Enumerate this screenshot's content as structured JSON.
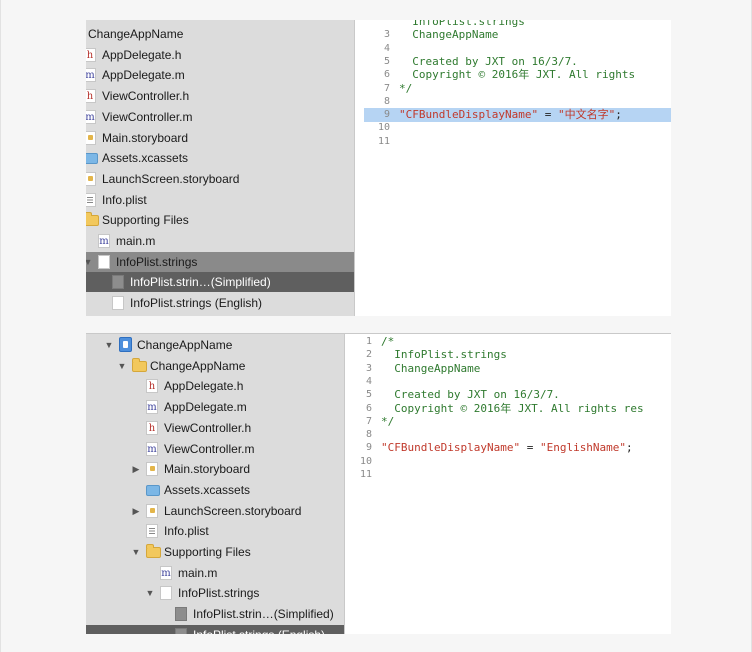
{
  "screens": [
    {
      "id": "simplified",
      "tree": [
        {
          "label": "ChangeAppName",
          "icon": "folder",
          "depth": 1,
          "disclosure": "open"
        },
        {
          "label": "AppDelegate.h",
          "icon": "h",
          "depth": 2
        },
        {
          "label": "AppDelegate.m",
          "icon": "m",
          "depth": 2
        },
        {
          "label": "ViewController.h",
          "icon": "h",
          "depth": 2
        },
        {
          "label": "ViewController.m",
          "icon": "m",
          "depth": 2
        },
        {
          "label": "Main.storyboard",
          "icon": "storyboard",
          "depth": 2,
          "disclosure": "closed"
        },
        {
          "label": "Assets.xcassets",
          "icon": "xcassets",
          "depth": 2
        },
        {
          "label": "LaunchScreen.storyboard",
          "icon": "storyboard",
          "depth": 2,
          "disclosure": "closed"
        },
        {
          "label": "Info.plist",
          "icon": "plist",
          "depth": 2
        },
        {
          "label": "Supporting Files",
          "icon": "folder",
          "depth": 2,
          "disclosure": "open"
        },
        {
          "label": "main.m",
          "icon": "m",
          "depth": 3
        },
        {
          "label": "InfoPlist.strings",
          "icon": "doc",
          "depth": 3,
          "disclosure": "open",
          "state": "selected"
        },
        {
          "label": "InfoPlist.strin…(Simplified)",
          "icon": "doc-grey",
          "depth": 4,
          "state": "active"
        },
        {
          "label": "InfoPlist.strings (English)",
          "icon": "doc",
          "depth": 4
        }
      ],
      "code": [
        {
          "n": "",
          "segments": [
            {
              "t": "  InfoPlist.strings",
              "c": "comment"
            }
          ]
        },
        {
          "n": "3",
          "segments": [
            {
              "t": "  ChangeAppName",
              "c": "comment"
            }
          ]
        },
        {
          "n": "4",
          "segments": []
        },
        {
          "n": "5",
          "segments": [
            {
              "t": "  Created by JXT on 16/3/7.",
              "c": "comment"
            }
          ]
        },
        {
          "n": "6",
          "segments": [
            {
              "t": "  Copyright © 2016年 JXT. All rights",
              "c": "comment"
            }
          ]
        },
        {
          "n": "7",
          "segments": [
            {
              "t": "*/",
              "c": "comment"
            }
          ]
        },
        {
          "n": "8",
          "segments": []
        },
        {
          "n": "9",
          "highlight": true,
          "segments": [
            {
              "t": "\"CFBundleDisplayName\"",
              "c": "str"
            },
            {
              "t": " = ",
              "c": "op"
            },
            {
              "t": "\"中文名字\"",
              "c": "str"
            },
            {
              "t": ";",
              "c": "op"
            }
          ]
        },
        {
          "n": "10",
          "segments": []
        },
        {
          "n": "11",
          "segments": []
        }
      ]
    },
    {
      "id": "english",
      "tree": [
        {
          "label": "ChangeAppName",
          "icon": "project",
          "depth": 0,
          "disclosure": "open"
        },
        {
          "label": "ChangeAppName",
          "icon": "folder",
          "depth": 1,
          "disclosure": "open"
        },
        {
          "label": "AppDelegate.h",
          "icon": "h",
          "depth": 2
        },
        {
          "label": "AppDelegate.m",
          "icon": "m",
          "depth": 2
        },
        {
          "label": "ViewController.h",
          "icon": "h",
          "depth": 2
        },
        {
          "label": "ViewController.m",
          "icon": "m",
          "depth": 2
        },
        {
          "label": "Main.storyboard",
          "icon": "storyboard",
          "depth": 2,
          "disclosure": "closed"
        },
        {
          "label": "Assets.xcassets",
          "icon": "xcassets",
          "depth": 2
        },
        {
          "label": "LaunchScreen.storyboard",
          "icon": "storyboard",
          "depth": 2,
          "disclosure": "closed"
        },
        {
          "label": "Info.plist",
          "icon": "plist",
          "depth": 2
        },
        {
          "label": "Supporting Files",
          "icon": "folder",
          "depth": 2,
          "disclosure": "open"
        },
        {
          "label": "main.m",
          "icon": "m",
          "depth": 3
        },
        {
          "label": "InfoPlist.strings",
          "icon": "doc",
          "depth": 3,
          "disclosure": "open"
        },
        {
          "label": "InfoPlist.strin…(Simplified)",
          "icon": "doc-grey",
          "depth": 4
        },
        {
          "label": "InfoPlist.strings (English)",
          "icon": "doc-grey",
          "depth": 4,
          "state": "active"
        }
      ],
      "code": [
        {
          "n": "1",
          "segments": [
            {
              "t": "/*",
              "c": "comment"
            }
          ]
        },
        {
          "n": "2",
          "segments": [
            {
              "t": "  InfoPlist.strings",
              "c": "comment"
            }
          ]
        },
        {
          "n": "3",
          "segments": [
            {
              "t": "  ChangeAppName",
              "c": "comment"
            }
          ]
        },
        {
          "n": "4",
          "segments": []
        },
        {
          "n": "5",
          "segments": [
            {
              "t": "  Created by JXT on 16/3/7.",
              "c": "comment"
            }
          ]
        },
        {
          "n": "6",
          "segments": [
            {
              "t": "  Copyright © 2016年 JXT. All rights res",
              "c": "comment"
            }
          ]
        },
        {
          "n": "7",
          "segments": [
            {
              "t": "*/",
              "c": "comment"
            }
          ]
        },
        {
          "n": "8",
          "segments": []
        },
        {
          "n": "9",
          "segments": [
            {
              "t": "\"CFBundleDisplayName\"",
              "c": "str"
            },
            {
              "t": " = ",
              "c": "op"
            },
            {
              "t": "\"EnglishName\"",
              "c": "str"
            },
            {
              "t": ";",
              "c": "op"
            }
          ]
        },
        {
          "n": "10",
          "segments": []
        },
        {
          "n": "11",
          "segments": []
        }
      ]
    }
  ]
}
